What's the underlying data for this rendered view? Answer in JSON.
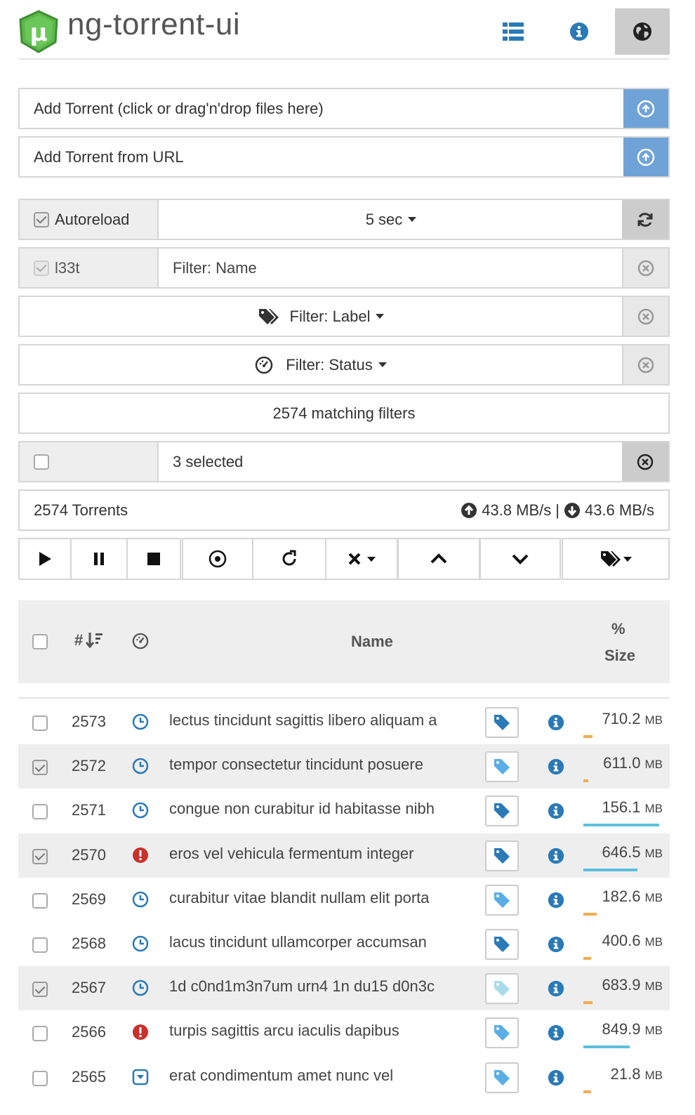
{
  "header": {
    "title": "ng-torrent-ui",
    "logo_letter": "µ",
    "buttons": [
      {
        "name": "list-view",
        "icon": "list-icon"
      },
      {
        "name": "about",
        "icon": "info-icon"
      },
      {
        "name": "webui",
        "icon": "globe-icon",
        "active": true
      }
    ]
  },
  "add": {
    "file_label": "Add Torrent (click or drag'n'drop files here)",
    "url_label": "Add Torrent from URL"
  },
  "autoreload": {
    "label": "Autoreload",
    "checked": true,
    "interval": "5 sec"
  },
  "filters": {
    "l33t_label": "l33t",
    "l33t_checked": true,
    "name_placeholder": "Filter: Name",
    "label_filter": "Filter: Label",
    "status_filter": "Filter: Status",
    "matching": "2574 matching filters"
  },
  "selection": {
    "text": "3 selected"
  },
  "stats": {
    "torrents": "2574 Torrents",
    "upload": "43.8 MB/s",
    "separator": "|",
    "download": "43.6 MB/s"
  },
  "colors": {
    "accent_blue": "#2a7ab8",
    "button_blue": "#6fa3d8",
    "green_logo": "#4caf3f",
    "error_red": "#c9302c",
    "progress_orange": "#f0ad4e",
    "progress_blue": "#5bc0de"
  },
  "table": {
    "headers": {
      "num": "#",
      "name": "Name",
      "percent": "%",
      "size": "Size"
    },
    "rows": [
      {
        "num": "2573",
        "status": "queued",
        "name": "lectus tincidunt sagittis libero aliquam a",
        "label_style": "dark",
        "size": "710.2",
        "unit": "MB",
        "selected": false,
        "progress": 0.12,
        "bar": "orange"
      },
      {
        "num": "2572",
        "status": "queued",
        "name": "tempor consectetur tincidunt posuere",
        "label_style": "light",
        "size": "611.0",
        "unit": "MB",
        "selected": true,
        "progress": 0.06,
        "bar": "orange"
      },
      {
        "num": "2571",
        "status": "queued",
        "name": "congue non curabitur id habitasse nibh",
        "label_style": "dark",
        "size": "156.1",
        "unit": "MB",
        "selected": false,
        "progress": 0.98,
        "bar": "blue"
      },
      {
        "num": "2570",
        "status": "error",
        "name": "eros vel vehicula fermentum integer",
        "label_style": "dark",
        "size": "646.5",
        "unit": "MB",
        "selected": true,
        "progress": 0.7,
        "bar": "blue"
      },
      {
        "num": "2569",
        "status": "queued",
        "name": "curabitur vitae blandit nullam elit porta",
        "label_style": "light",
        "size": "182.6",
        "unit": "MB",
        "selected": false,
        "progress": 0.17,
        "bar": "orange"
      },
      {
        "num": "2568",
        "status": "queued",
        "name": "lacus tincidunt ullamcorper accumsan",
        "label_style": "dark",
        "size": "400.6",
        "unit": "MB",
        "selected": false,
        "progress": 0.1,
        "bar": "orange"
      },
      {
        "num": "2567",
        "status": "queued",
        "name": "1d c0nd1m3n7um urn4 1n du15 d0n3c",
        "label_style": "pale",
        "size": "683.9",
        "unit": "MB",
        "selected": true,
        "progress": 0.12,
        "bar": "orange"
      },
      {
        "num": "2566",
        "status": "error",
        "name": "turpis sagittis arcu iaculis dapibus",
        "label_style": "light",
        "size": "849.9",
        "unit": "MB",
        "selected": false,
        "progress": 0.6,
        "bar": "blue"
      },
      {
        "num": "2565",
        "status": "download",
        "name": "erat condimentum amet nunc vel",
        "label_style": "light",
        "size": "21.8",
        "unit": "MB",
        "selected": false,
        "progress": 0.1,
        "bar": "orange"
      }
    ]
  }
}
